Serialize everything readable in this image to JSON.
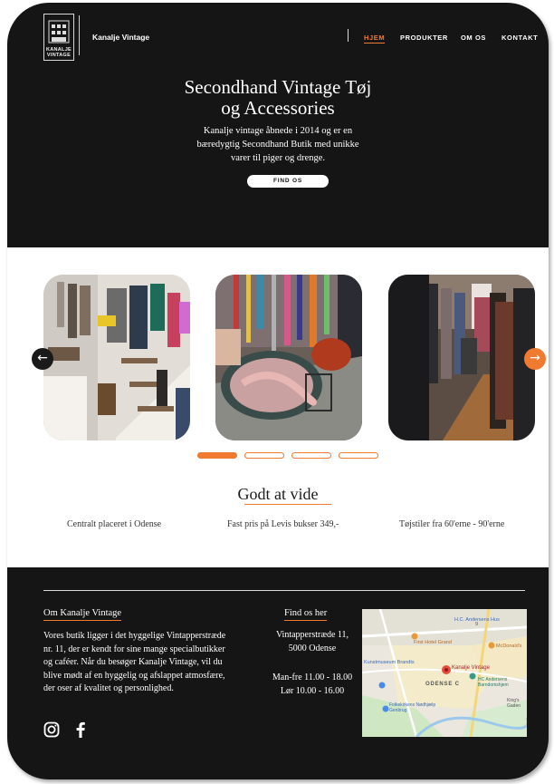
{
  "header": {
    "logo_lines": [
      "KANALJE",
      "VINTAGE"
    ],
    "brand": "Kanalje Vintage",
    "nav": [
      {
        "label": "HJEM",
        "active": true
      },
      {
        "label": "PRODUKTER",
        "active": false
      },
      {
        "label": "OM OS",
        "active": false
      },
      {
        "label": "KONTAKT",
        "active": false
      }
    ]
  },
  "hero": {
    "title_line1": "Secondhand Vintage Tøj",
    "title_line2": "og Accessories",
    "subtitle": "Kanalje vintage åbnede i 2014 og er en bæredygtig Secondhand Butik med unikke varer til piger og drenge.",
    "cta": "FIND OS"
  },
  "carousel": {
    "prev_icon": "arrow-left-icon",
    "next_icon": "arrow-right-icon",
    "slides": [
      "shop-staircase-photo",
      "jewelry-table-photo",
      "clothing-racks-photo"
    ],
    "active_dot": 0,
    "dot_count": 4
  },
  "know": {
    "title": "Godt at vide",
    "facts": [
      "Centralt placeret i Odense",
      "Fast pris på Levis bukser 349,-",
      "Tøjstiler fra 60'erne - 90'erne"
    ]
  },
  "footer": {
    "about_title": "Om Kanalje Vintage",
    "about_text": "Vores butik ligger i det hyggelige Vintapperstræde nr. 11, der er kendt for sine mange specialbutikker og caféer. Når du besøger Kanalje Vintage, vil du blive mødt af en hyggelig og afslappet atmosfære, der oser af kvalitet og personlighed.",
    "find_title": "Find os her",
    "address_line1": "Vintapperstræde 11,",
    "address_line2": "5000 Odense",
    "hours_line1": "Man-fre 11.00 - 18.00",
    "hours_line2": "Lør 10.00 - 16.00",
    "map_labels": {
      "pin": "Kanalje Vintage",
      "district": "ODENSE C",
      "hotel": "First Hotel Grand",
      "museum": "Kunstmuseum Brandts",
      "andersen": "H.C. Andersens Hus",
      "andersen_house": "HC Andersens Barndomshjem",
      "mcdonalds": "McDonald's",
      "folkekirken": "Folkekirkens Nødhjælp Genbrug",
      "road_num": "9",
      "kings": "King's Gaden"
    },
    "social": [
      "instagram-icon",
      "facebook-icon"
    ]
  },
  "colors": {
    "accent": "#f07a2f",
    "dark": "#151515"
  }
}
